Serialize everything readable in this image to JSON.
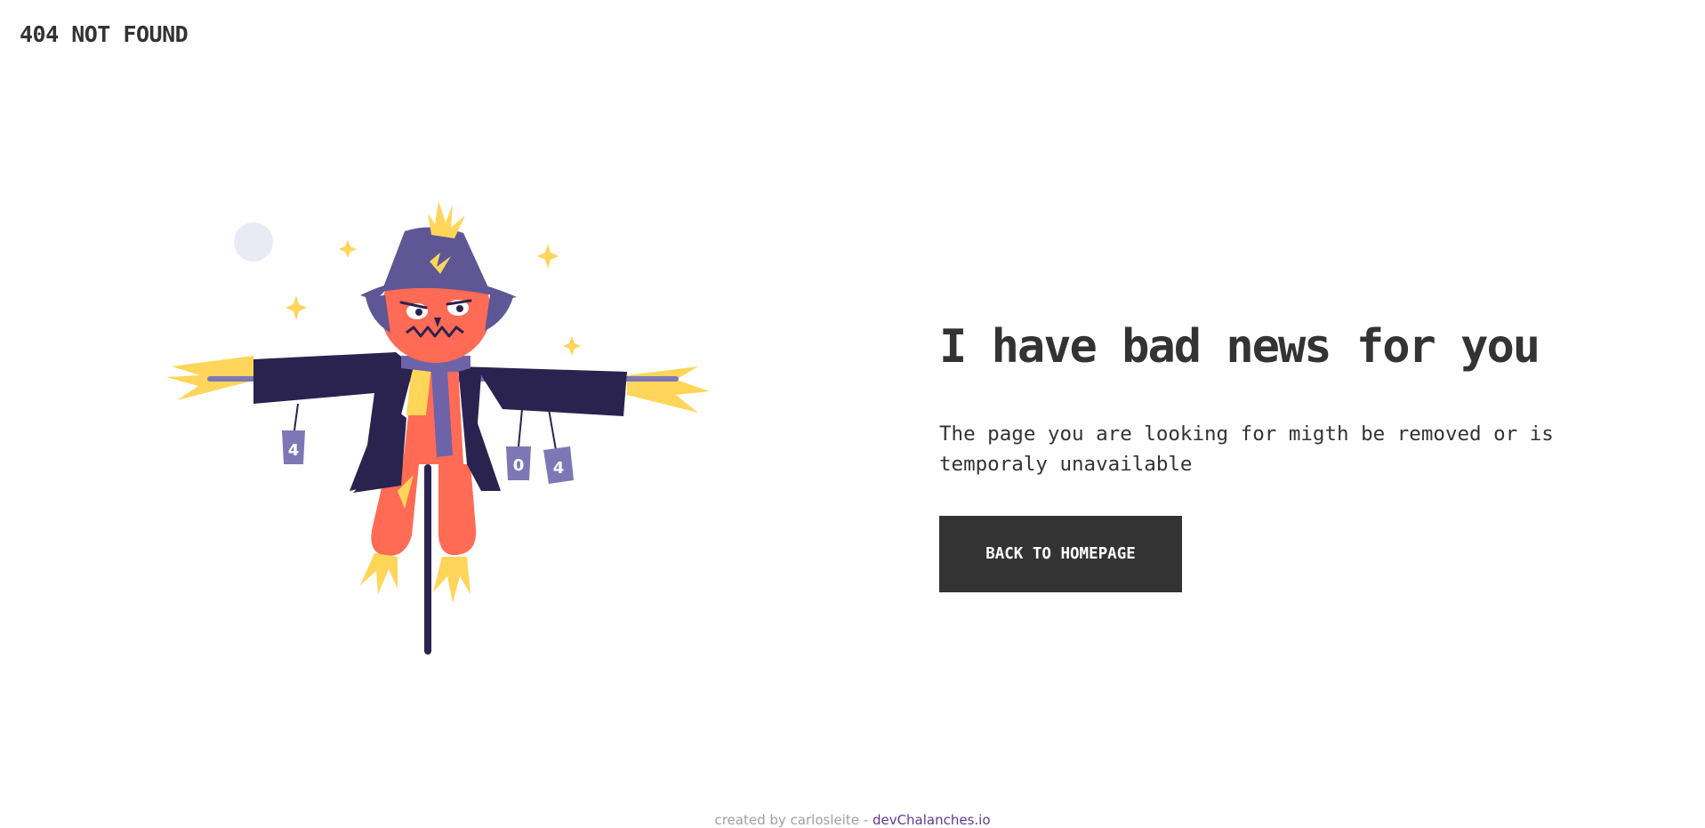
{
  "header": {
    "title": "404 NOT FOUND"
  },
  "illustration": {
    "icon": "scarecrow-illustration",
    "can_labels": [
      "4",
      "0",
      "4"
    ],
    "colors": {
      "coat": "#2a2350",
      "hat": "#5e5695",
      "face": "#ff6b55",
      "straw": "#ffd55a",
      "scarf": "#6e63a8",
      "can": "#7f77b5",
      "moon": "#e8ebf3",
      "stars": "#ffd55a"
    }
  },
  "main": {
    "headline": "I have bad news for you",
    "message": "The page you are looking for migth be removed or is temporaly unavailable",
    "button_label": "BACK TO HOMEPAGE"
  },
  "footer": {
    "prefix": "created by carlosleite - ",
    "link_label": "devChalanches.io"
  },
  "theme": {
    "text": "#333333",
    "button_bg": "#333333",
    "button_text": "#ffffff",
    "footer_text": "#a0a0a0",
    "footer_link": "#5a3d8f"
  }
}
